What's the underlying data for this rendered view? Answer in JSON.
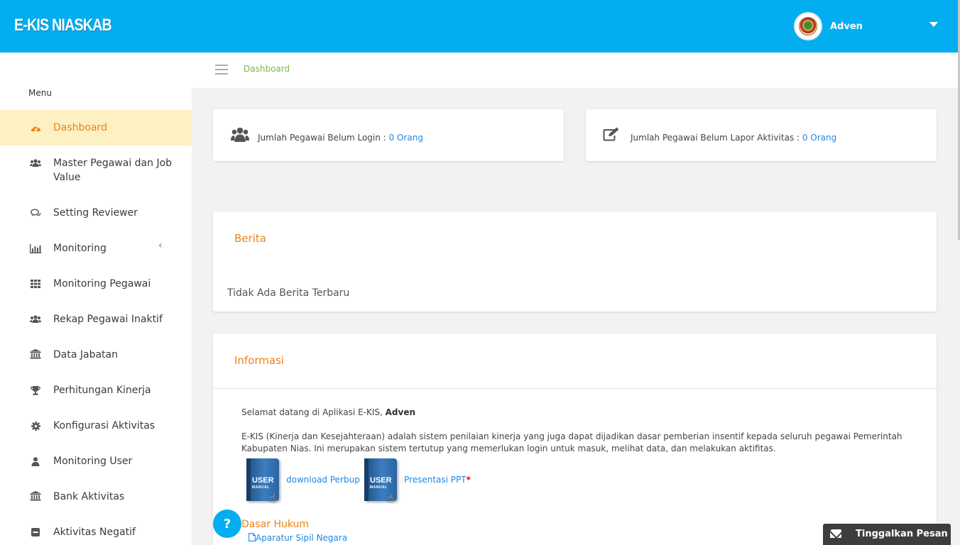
{
  "header": {
    "logo": "E-KIS NIASKAB",
    "user_name": "Adven"
  },
  "breadcrumb": {
    "current": "Dashboard"
  },
  "sidebar": {
    "menu_title": "Menu",
    "items": [
      {
        "label": "Dashboard",
        "icon": "dashboard-icon",
        "active": true
      },
      {
        "label": "Master Pegawai dan Job Value",
        "icon": "users-icon"
      },
      {
        "label": "Setting Reviewer",
        "icon": "comments-icon"
      },
      {
        "label": "Monitoring",
        "icon": "bar-chart-icon",
        "has_submenu": true
      },
      {
        "label": "Monitoring Pegawai",
        "icon": "grid-icon"
      },
      {
        "label": "Rekap Pegawai Inaktif",
        "icon": "users-icon"
      },
      {
        "label": "Data Jabatan",
        "icon": "institution-icon"
      },
      {
        "label": "Perhitungan Kinerja",
        "icon": "trophy-icon"
      },
      {
        "label": "Konfigurasi Aktivitas",
        "icon": "gear-icon"
      },
      {
        "label": "Monitoring User",
        "icon": "user-icon"
      },
      {
        "label": "Bank Aktivitas",
        "icon": "institution-icon"
      },
      {
        "label": "Aktivitas Negatif",
        "icon": "minus-square-icon"
      }
    ]
  },
  "stats": {
    "login": {
      "label": "Jumlah Pegawai Belum Login : ",
      "value": "0 Orang"
    },
    "lapor": {
      "label": "Jumlah Pegawai Belum Lapor Aktivitas : ",
      "value": "0 Orang"
    }
  },
  "berita": {
    "title": "Berita",
    "empty_text": "Tidak Ada Berita Terbaru"
  },
  "informasi": {
    "title": "Informasi",
    "welcome_prefix": "Selamat datang di Aplikasi E-KIS, ",
    "welcome_name": "Adven",
    "description": "E-KIS (Kinerja dan Kesejahteraan) adalah sistem penilaian kinerja yang juga dapat dijadikan dasar pemberian insentif kepada seluruh pegawai Pemerintah Kabupaten Nias. Ini merupakan sistem tertutup yang memerlukan login untuk masuk, melihat data, dan melakukan aktifitas.",
    "book_title": "USER",
    "book_subtitle": "MANUAL",
    "download_perbup": "download Perbup",
    "presentasi": "Presentasi PPT",
    "required_mark": "*",
    "dasar_hukum": "Dasar Hukum",
    "asn_link": "Aparatur Sipil Negara"
  },
  "widgets": {
    "help": "?",
    "chat_label": "Tinggalkan Pesan"
  },
  "colors": {
    "topbar": "#02aeef",
    "accent_orange": "#f08016",
    "link_blue": "#1e88e5",
    "active_bg": "#fdf0c2",
    "breadcrumb_green": "#7ab648"
  }
}
